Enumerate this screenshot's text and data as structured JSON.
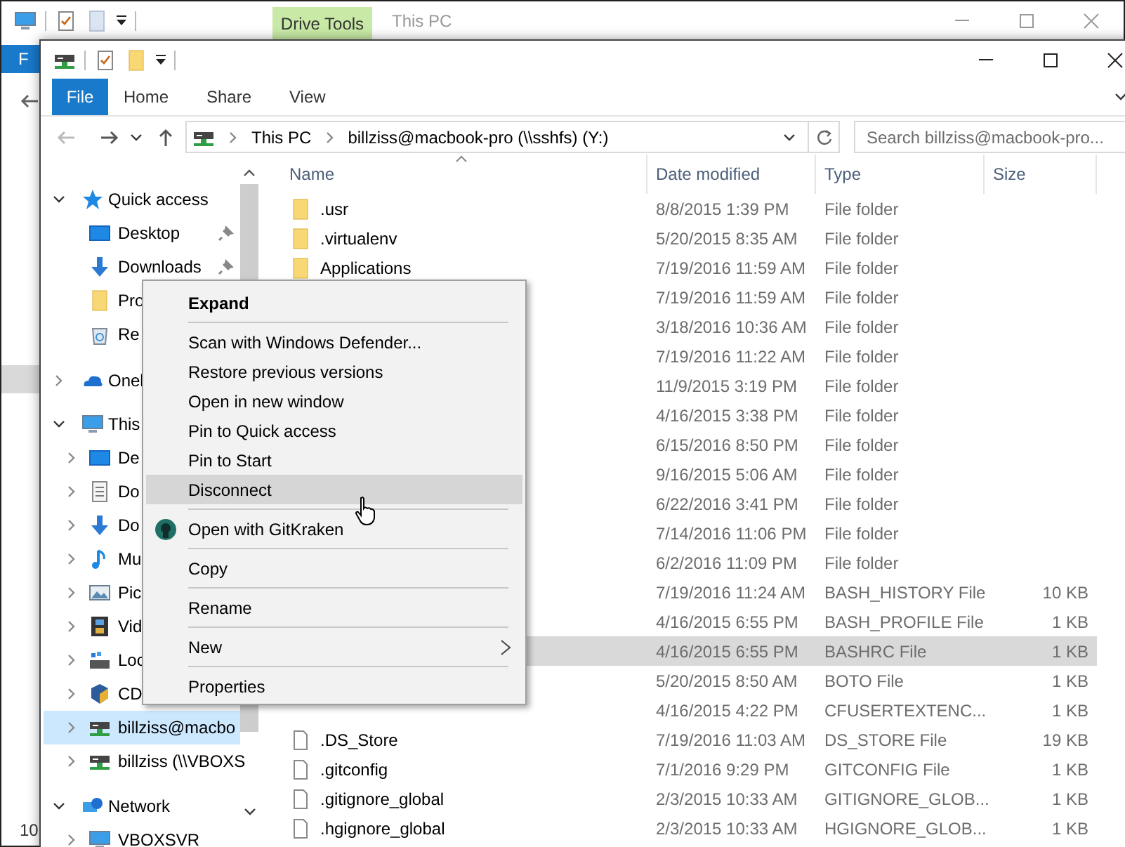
{
  "background_window": {
    "contextual_tab": "Drive Tools",
    "title": "This PC",
    "file_tab": "F",
    "status_text": "10"
  },
  "window": {
    "ribbon_tabs": [
      {
        "label": "File",
        "selected": true
      },
      {
        "label": "Home",
        "selected": false
      },
      {
        "label": "Share",
        "selected": false
      },
      {
        "label": "View",
        "selected": false
      }
    ],
    "address_bar": {
      "crumbs": [
        "This PC",
        "billziss@macbook-pro (\\\\sshfs) (Y:)"
      ]
    },
    "search": {
      "placeholder": "Search billziss@macbook-pro..."
    },
    "nav_pane": {
      "items": [
        {
          "label": "Quick access",
          "expanded": true,
          "selected": false,
          "children": [
            {
              "label": "Desktop",
              "pinned": true,
              "selected": false
            },
            {
              "label": "Downloads",
              "pinned": true,
              "selected": false
            },
            {
              "label": "Pro",
              "selected": false
            },
            {
              "label": "Re",
              "selected": false
            }
          ]
        },
        {
          "label": "Onel",
          "expanded": false,
          "selected": false
        },
        {
          "label": "This",
          "expanded": true,
          "selected": false,
          "children": [
            {
              "label": "De",
              "expanded": false,
              "selected": false
            },
            {
              "label": "Do",
              "expanded": false,
              "selected": false
            },
            {
              "label": "Do",
              "expanded": false,
              "selected": false
            },
            {
              "label": "Mu",
              "expanded": false,
              "selected": false
            },
            {
              "label": "Pic",
              "expanded": false,
              "selected": false
            },
            {
              "label": "Vid",
              "expanded": false,
              "selected": false
            },
            {
              "label": "Loc",
              "expanded": false,
              "selected": false
            },
            {
              "label": "CD",
              "expanded": false,
              "selected": false
            },
            {
              "label": "billziss@macbo",
              "expanded": false,
              "selected": true
            },
            {
              "label": "billziss (\\\\VBOXS",
              "expanded": false,
              "selected": false
            }
          ]
        },
        {
          "label": "Network",
          "expanded": true,
          "selected": false,
          "children": [
            {
              "label": "VBOXSVR",
              "expanded": false,
              "selected": false
            }
          ]
        }
      ]
    },
    "columns": [
      "Name",
      "Date modified",
      "Type",
      "Size"
    ],
    "rows": [
      {
        "name": ".usr",
        "kind": "folder",
        "date": "8/8/2015 1:39 PM",
        "type": "File folder",
        "selected": false
      },
      {
        "name": ".virtualenv",
        "kind": "folder",
        "date": "5/20/2015 8:35 AM",
        "type": "File folder",
        "selected": false
      },
      {
        "name": "Applications",
        "kind": "folder",
        "date": "7/19/2016 11:59 AM",
        "type": "File folder",
        "selected": false
      },
      {
        "date": "7/19/2016 11:59 AM",
        "type": "File folder",
        "selected": false
      },
      {
        "date": "3/18/2016 10:36 AM",
        "type": "File folder",
        "selected": false
      },
      {
        "date": "7/19/2016 11:22 AM",
        "type": "File folder",
        "selected": false
      },
      {
        "date": "11/9/2015 3:19 PM",
        "type": "File folder",
        "selected": false
      },
      {
        "date": "4/16/2015 3:38 PM",
        "type": "File folder",
        "selected": false
      },
      {
        "date": "6/15/2016 8:50 PM",
        "type": "File folder",
        "selected": false
      },
      {
        "date": "9/16/2015 5:06 AM",
        "type": "File folder",
        "selected": false
      },
      {
        "date": "6/22/2016 3:41 PM",
        "type": "File folder",
        "selected": false
      },
      {
        "date": "7/14/2016 11:06 PM",
        "type": "File folder",
        "selected": false
      },
      {
        "date": "6/2/2016 11:09 PM",
        "type": "File folder",
        "selected": false
      },
      {
        "date": "7/19/2016 11:24 AM",
        "type": "BASH_HISTORY File",
        "size": "10 KB",
        "selected": false
      },
      {
        "date": "4/16/2015 6:55 PM",
        "type": "BASH_PROFILE File",
        "size": "1 KB",
        "selected": false
      },
      {
        "date": "4/16/2015 6:55 PM",
        "type": "BASHRC File",
        "size": "1 KB",
        "selected": true
      },
      {
        "date": "5/20/2015 8:50 AM",
        "type": "BOTO File",
        "size": "1 KB",
        "selected": false
      },
      {
        "date": "4/16/2015 4:22 PM",
        "type": "CFUSERTEXTENC...",
        "size": "1 KB",
        "selected": false
      },
      {
        "name": ".DS_Store",
        "kind": "file",
        "date": "7/19/2016 11:03 AM",
        "type": "DS_STORE File",
        "size": "19 KB",
        "selected": false
      },
      {
        "name": ".gitconfig",
        "kind": "file",
        "date": "7/1/2016 9:29 PM",
        "type": "GITCONFIG File",
        "size": "1 KB",
        "selected": false
      },
      {
        "name": ".gitignore_global",
        "kind": "file",
        "date": "2/3/2015 10:33 AM",
        "type": "GITIGNORE_GLOB...",
        "size": "1 KB",
        "selected": false
      },
      {
        "name": ".hgignore_global",
        "kind": "file",
        "date": "2/3/2015 10:33 AM",
        "type": "HGIGNORE_GLOB...",
        "size": "1 KB",
        "selected": false
      }
    ],
    "context_menu": {
      "items": [
        {
          "kind": "header",
          "label": "Expand",
          "selected": false
        },
        {
          "kind": "separator"
        },
        {
          "kind": "item",
          "label": "Scan with Windows Defender...",
          "selected": false
        },
        {
          "kind": "item",
          "label": "Restore previous versions",
          "selected": false
        },
        {
          "kind": "item",
          "label": "Open in new window",
          "selected": false
        },
        {
          "kind": "item",
          "label": "Pin to Quick access",
          "selected": false
        },
        {
          "kind": "item",
          "label": "Pin to Start",
          "selected": false
        },
        {
          "kind": "item",
          "label": "Disconnect",
          "selected": true
        },
        {
          "kind": "separator"
        },
        {
          "kind": "app",
          "label": "Open with GitKraken",
          "selected": false
        },
        {
          "kind": "separator"
        },
        {
          "kind": "item",
          "label": "Copy",
          "selected": false
        },
        {
          "kind": "separator"
        },
        {
          "kind": "item",
          "label": "Rename",
          "selected": false
        },
        {
          "kind": "separator"
        },
        {
          "kind": "submenu",
          "label": "New",
          "selected": false
        },
        {
          "kind": "separator"
        },
        {
          "kind": "item",
          "label": "Properties",
          "selected": false
        }
      ]
    }
  }
}
